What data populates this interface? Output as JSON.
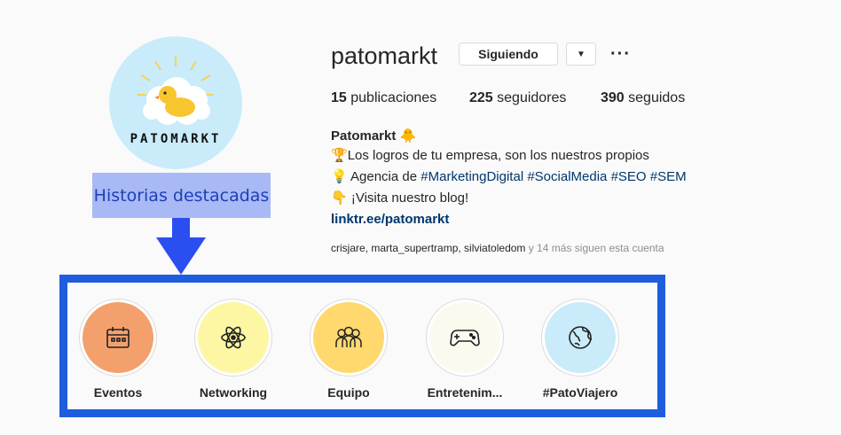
{
  "profile": {
    "username": "patomarkt",
    "avatar_text": "PATOMARKT",
    "follow_label": "Siguiendo",
    "more_label": "···",
    "stats": {
      "posts_count": "15",
      "posts_label": "publicaciones",
      "followers_count": "225",
      "followers_label": "seguidores",
      "following_count": "390",
      "following_label": "seguidos"
    },
    "bio": {
      "name": "Patomarkt",
      "name_emoji": "🐥",
      "line1_emoji": "🏆",
      "line1": "Los logros de tu empresa, son los nuestros propios",
      "line2_emoji": "💡",
      "line2_text": " Agencia de ",
      "tags": [
        "#MarketingDigital",
        "#SocialMedia",
        "#SEO",
        "#SEM"
      ],
      "line3_emoji": "👇",
      "line3": " ¡Visita nuestro blog!",
      "link": "linktr.ee/patomarkt"
    },
    "followed_by": {
      "names": "crisjare, marta_supertramp, silviatoledom",
      "more": " y 14 más siguen esta cuenta"
    }
  },
  "annotation": {
    "label": "Historias destacadas"
  },
  "highlights": [
    {
      "label": "Eventos",
      "icon": "calendar-icon",
      "color": "#f4a06c"
    },
    {
      "label": "Networking",
      "icon": "atom-icon",
      "color": "#fdf7a4"
    },
    {
      "label": "Equipo",
      "icon": "team-icon",
      "color": "#ffd86e"
    },
    {
      "label": "Entretenim...",
      "icon": "gamepad-icon",
      "color": "#fcf9ee"
    },
    {
      "label": "#PatoViajero",
      "icon": "globe-icon",
      "color": "#c9ebfa"
    }
  ],
  "colors": {
    "highlight_border": "#1f5ddf",
    "annotation_bg": "#a8b9f5",
    "annotation_text": "#1e3fb8",
    "link": "#00376b"
  }
}
